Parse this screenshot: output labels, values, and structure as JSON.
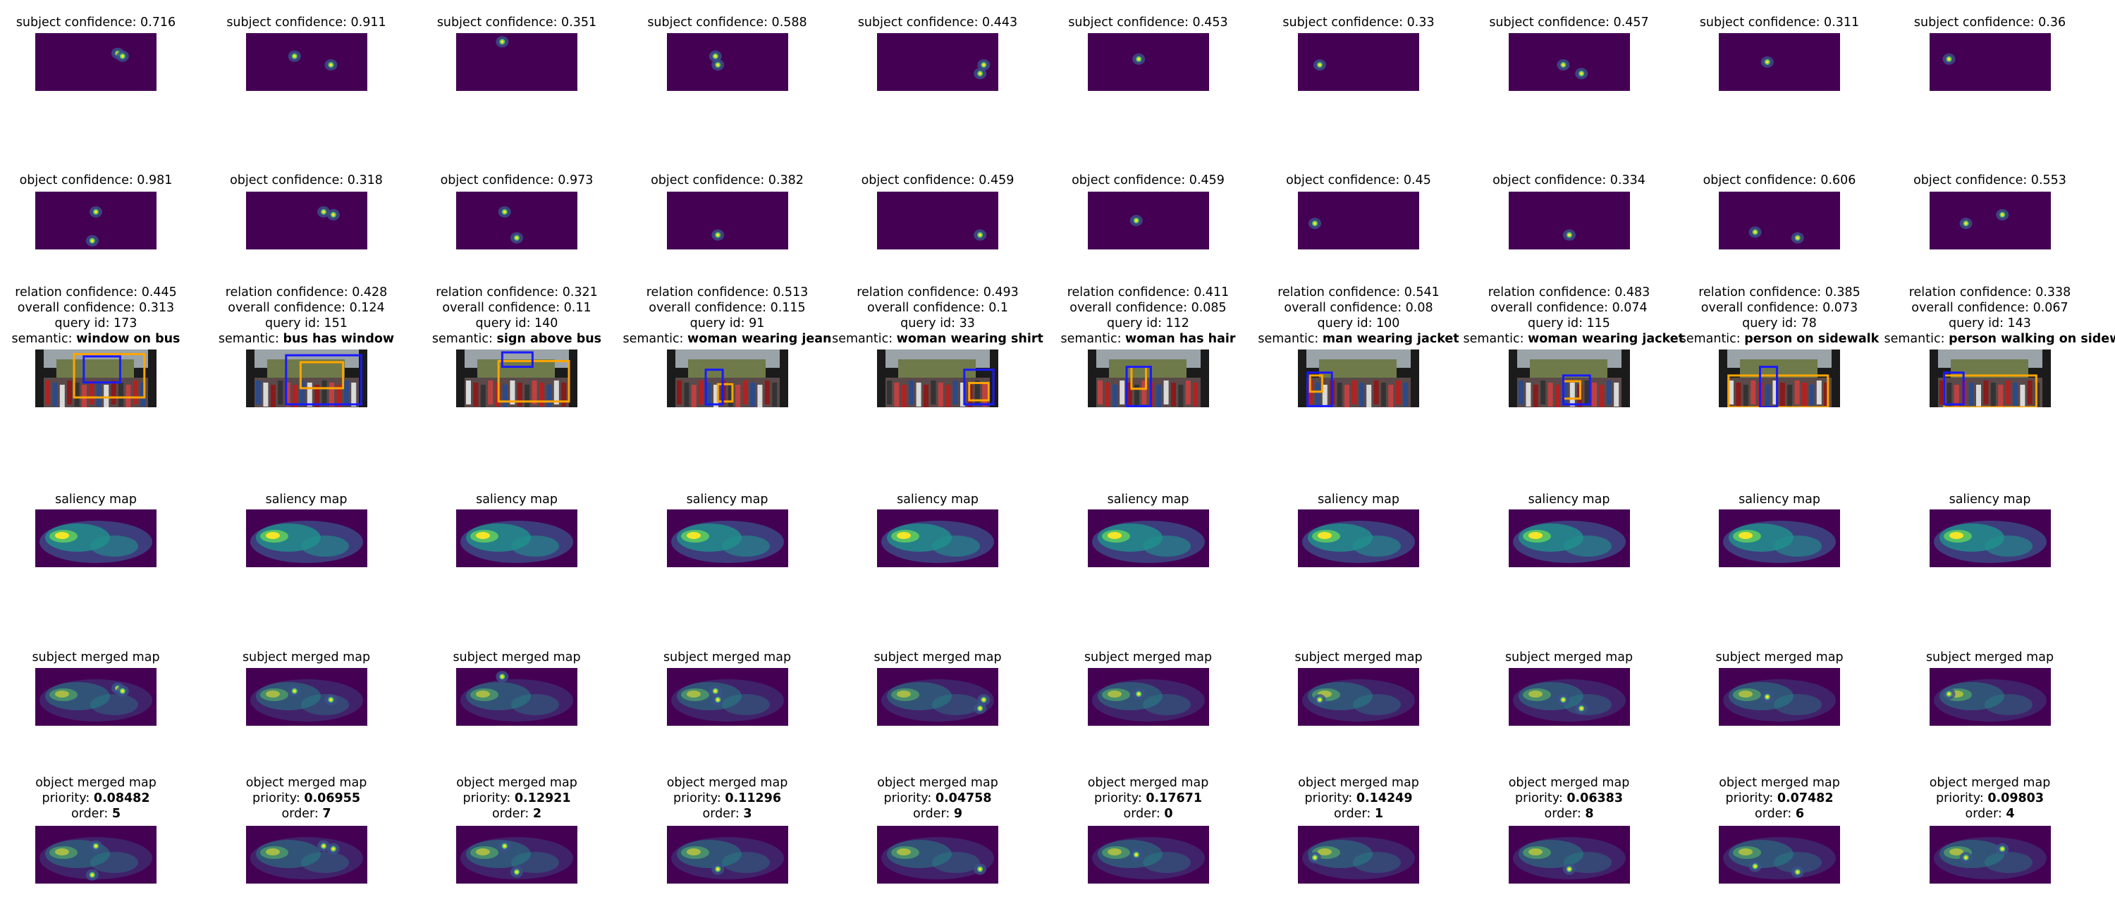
{
  "chart_data": {
    "type": "heatmap",
    "columns": [
      {
        "subject_confidence": "0.716",
        "object_confidence": "0.981",
        "relation_confidence": "0.445",
        "overall_confidence": "0.313",
        "query_id": "173",
        "semantic": "window on bus",
        "priority": "0.08482",
        "order": "5"
      },
      {
        "subject_confidence": "0.911",
        "object_confidence": "0.318",
        "relation_confidence": "0.428",
        "overall_confidence": "0.124",
        "query_id": "151",
        "semantic": "bus has window",
        "priority": "0.06955",
        "order": "7"
      },
      {
        "subject_confidence": "0.351",
        "object_confidence": "0.973",
        "relation_confidence": "0.321",
        "overall_confidence": "0.11",
        "query_id": "140",
        "semantic": "sign above bus",
        "priority": "0.12921",
        "order": "2"
      },
      {
        "subject_confidence": "0.588",
        "object_confidence": "0.382",
        "relation_confidence": "0.513",
        "overall_confidence": "0.115",
        "query_id": "91",
        "semantic": "woman wearing jean",
        "priority": "0.11296",
        "order": "3"
      },
      {
        "subject_confidence": "0.443",
        "object_confidence": "0.459",
        "relation_confidence": "0.493",
        "overall_confidence": "0.1",
        "query_id": "33",
        "semantic": "woman wearing shirt",
        "priority": "0.04758",
        "order": "9"
      },
      {
        "subject_confidence": "0.453",
        "object_confidence": "0.459",
        "relation_confidence": "0.411",
        "overall_confidence": "0.085",
        "query_id": "112",
        "semantic": "woman has hair",
        "priority": "0.17671",
        "order": "0"
      },
      {
        "subject_confidence": "0.33",
        "object_confidence": "0.45",
        "relation_confidence": "0.541",
        "overall_confidence": "0.08",
        "query_id": "100",
        "semantic": "man wearing jacket",
        "priority": "0.14249",
        "order": "1"
      },
      {
        "subject_confidence": "0.457",
        "object_confidence": "0.334",
        "relation_confidence": "0.483",
        "overall_confidence": "0.074",
        "query_id": "115",
        "semantic": "woman wearing jacket",
        "priority": "0.06383",
        "order": "8"
      },
      {
        "subject_confidence": "0.311",
        "object_confidence": "0.606",
        "relation_confidence": "0.385",
        "overall_confidence": "0.073",
        "query_id": "78",
        "semantic": "person on sidewalk",
        "priority": "0.07482",
        "order": "6"
      },
      {
        "subject_confidence": "0.36",
        "object_confidence": "0.553",
        "relation_confidence": "0.338",
        "overall_confidence": "0.067",
        "query_id": "143",
        "semantic": "person walking on sidewalk",
        "priority": "0.09803",
        "order": "4"
      }
    ],
    "row_titles": {
      "subject": "subject confidence",
      "object": "object confidence",
      "relation": "relation confidence",
      "overall": "overall confidence",
      "query": "query id",
      "semantic": "semantic",
      "saliency": "saliency map",
      "subject_merged": "subject merged map",
      "object_merged": "object merged map",
      "priority": "priority",
      "order": "order"
    },
    "colormap": [
      "#440154",
      "#3b528b",
      "#21918c",
      "#5ec962",
      "#fde725"
    ],
    "box_colors": {
      "subject": "#1a1aff",
      "object": "#ffa500"
    }
  }
}
